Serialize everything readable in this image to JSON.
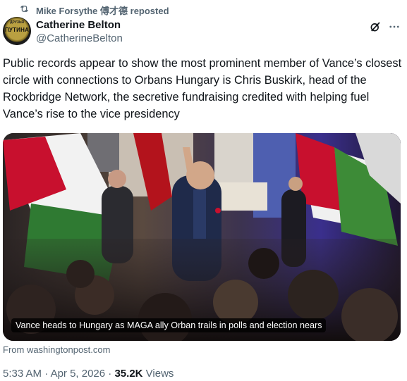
{
  "repost": {
    "text": "Mike Forsythe 傅才德 reposted",
    "icon": "repost-icon"
  },
  "author": {
    "name": "Catherine Belton",
    "handle": "@CatherineBelton",
    "avatar_text_top": "ДРУЗЬЯ",
    "avatar_text": "ПУТИНА"
  },
  "tweet": {
    "text": "Public records appear to show the most prominent member of Vance’s closest circle with connections to Orbans Hungary is Chris Buskirk, head of the Rockbridge Network, the secretive fundraising credited with helping fuel Vance’s rise to the vice presidency"
  },
  "card": {
    "caption": "Vance heads to Hungary as MAGA ally Orban trails in polls and election nears",
    "source": "From washingtonpost.com"
  },
  "meta": {
    "time": "5:33 AM",
    "sep1": " · ",
    "date": "Apr 5, 2026",
    "sep2": " · ",
    "views_count": "35.2K",
    "views_label": " Views"
  },
  "colors": {
    "text": "#0f1419",
    "muted": "#536471",
    "flag_red": "#c8102e",
    "flag_green": "#3d8b37"
  }
}
